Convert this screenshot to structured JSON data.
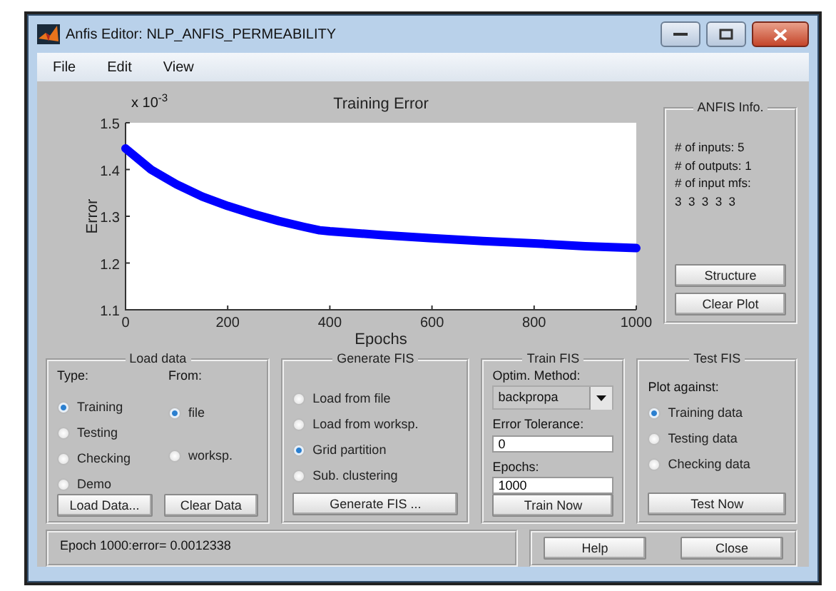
{
  "window": {
    "title": "Anfis Editor: NLP_ANFIS_PERMEABILITY"
  },
  "menu": [
    "File",
    "Edit",
    "View"
  ],
  "plot": {
    "exponent_label": "x 10$^{-3}$",
    "chart_data": {
      "type": "line",
      "title": "Training Error",
      "xlabel": "Epochs",
      "ylabel": "Error",
      "x": [
        0,
        50,
        100,
        150,
        200,
        250,
        300,
        350,
        380,
        400,
        500,
        600,
        700,
        800,
        900,
        1000
      ],
      "series": [
        {
          "color": "#0000ff",
          "values": [
            1.445,
            1.4,
            1.368,
            1.342,
            1.322,
            1.305,
            1.29,
            1.277,
            1.27,
            1.268,
            1.26,
            1.253,
            1.247,
            1.242,
            1.236,
            1.232
          ]
        }
      ],
      "xlim": [
        0,
        1000
      ],
      "ylim": [
        1.1,
        1.5
      ],
      "xticks": [
        0,
        200,
        400,
        600,
        800,
        1000
      ],
      "yticks": [
        1.1,
        1.2,
        1.3,
        1.4,
        1.5
      ]
    }
  },
  "anfis_info": {
    "title": "ANFIS Info.",
    "lines": [
      "# of inputs: 5",
      "# of outputs: 1",
      "# of input mfs:",
      "3  3  3  3  3"
    ],
    "buttons": [
      "Structure",
      "Clear Plot"
    ]
  },
  "load_data": {
    "title": "Load data",
    "type_label": "Type:",
    "from_label": "From:",
    "types": [
      {
        "label": "Training",
        "selected": true
      },
      {
        "label": "Testing",
        "selected": false
      },
      {
        "label": "Checking",
        "selected": false
      },
      {
        "label": "Demo",
        "selected": false
      }
    ],
    "sources": [
      {
        "label": "file",
        "selected": true
      },
      {
        "label": "worksp.",
        "selected": false
      }
    ],
    "buttons": [
      "Load Data...",
      "Clear Data"
    ]
  },
  "generate_fis": {
    "title": "Generate FIS",
    "options": [
      {
        "label": "Load from file",
        "selected": false
      },
      {
        "label": "Load from worksp.",
        "selected": false
      },
      {
        "label": "Grid partition",
        "selected": true
      },
      {
        "label": "Sub. clustering",
        "selected": false
      }
    ],
    "button": "Generate FIS ..."
  },
  "train_fis": {
    "title": "Train FIS",
    "method_label": "Optim. Method:",
    "method": "backpropa",
    "tolerance_label": "Error Tolerance:",
    "tolerance": "0",
    "epochs_label": "Epochs:",
    "epochs": "1000",
    "button": "Train Now"
  },
  "test_fis": {
    "title": "Test FIS",
    "plot_label": "Plot against:",
    "options": [
      {
        "label": "Training data",
        "selected": true
      },
      {
        "label": "Testing data",
        "selected": false
      },
      {
        "label": "Checking data",
        "selected": false
      }
    ],
    "button": "Test Now"
  },
  "status": "Epoch 1000:error= 0.0012338",
  "buttons": [
    "Help",
    "Close"
  ]
}
